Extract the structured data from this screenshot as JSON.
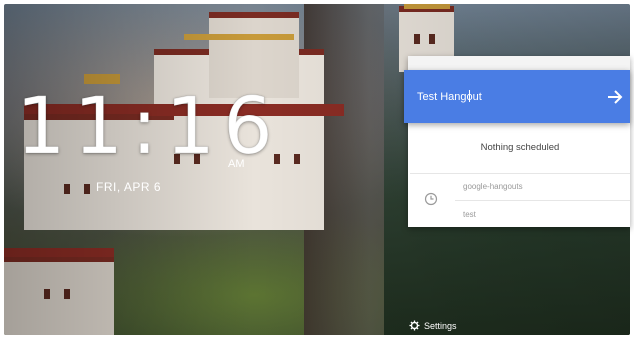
{
  "clock": {
    "time": "11:16",
    "ampm": "AM",
    "date": "FRI, APR 6"
  },
  "hangout": {
    "input_value": "Test Hangout",
    "go_icon": "arrow-right-icon"
  },
  "schedule": {
    "empty_text": "Nothing scheduled"
  },
  "event": {
    "title": "google-hangouts",
    "subtitle": "test",
    "icon": "clock-icon"
  },
  "footer": {
    "settings_label": "Settings",
    "settings_icon": "gear-icon"
  },
  "colors": {
    "accent": "#4a7de4"
  }
}
